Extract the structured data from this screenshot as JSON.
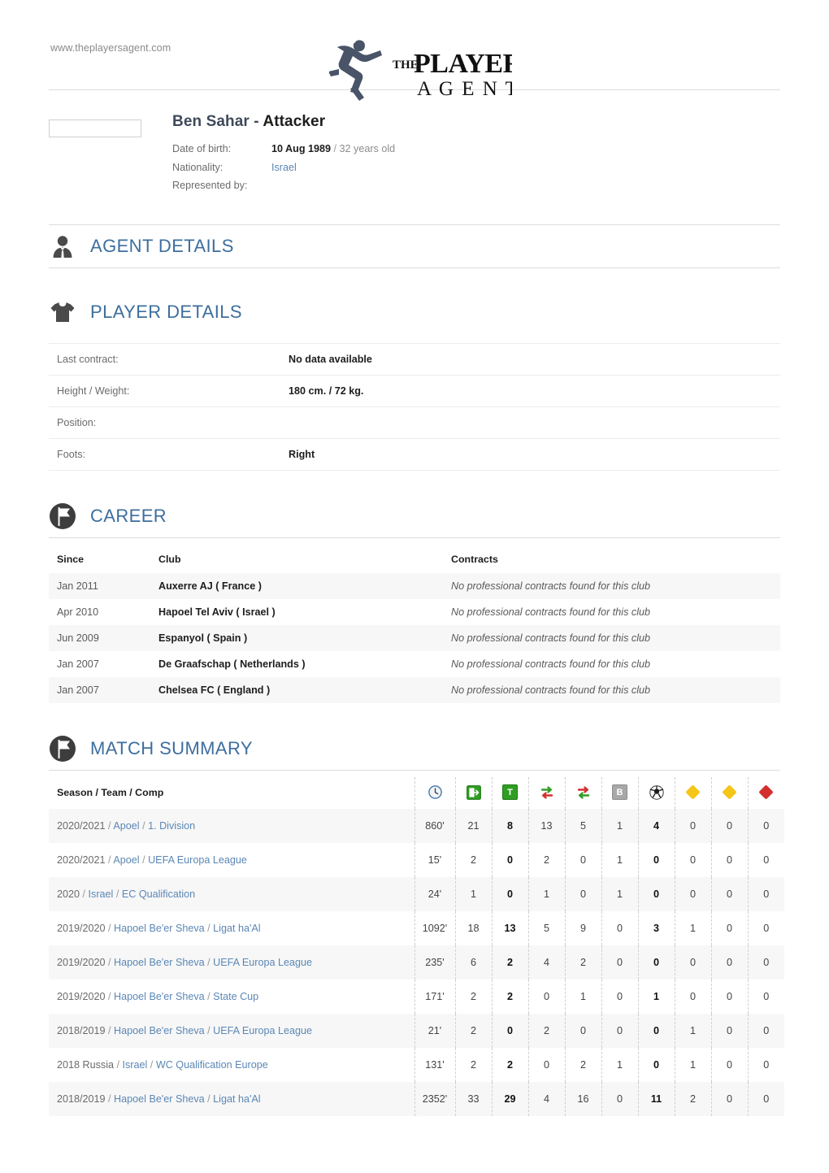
{
  "header": {
    "site_url": "www.theplayersagent.com",
    "logo_the": "THE",
    "logo_players": "PLAYERS'",
    "logo_agent": "A G E N T"
  },
  "player": {
    "name": "Ben Sahar",
    "name_separator": " - ",
    "position_title": "Attacker",
    "dob_label": "Date of birth:",
    "dob_value": "10 Aug 1989",
    "dob_separator": " / ",
    "age": "32 years old",
    "nationality_label": "Nationality:",
    "nationality_value": "Israel",
    "represented_label": "Represented by:",
    "represented_value": ""
  },
  "sections": {
    "agent_details": {
      "title": "AGENT DETAILS",
      "icon": "person-icon"
    },
    "player_details": {
      "title": "PLAYER DETAILS",
      "icon": "tshirt-icon"
    },
    "career": {
      "title": "CAREER",
      "icon": "flag-badge-icon"
    },
    "match_summary": {
      "title": "MATCH SUMMARY",
      "icon": "flag-badge-icon"
    }
  },
  "player_details": {
    "rows": [
      {
        "label": "Last contract:",
        "value": "No data available"
      },
      {
        "label": "Height / Weight:",
        "value": "180 cm. / 72 kg."
      },
      {
        "label": "Position:",
        "value": ""
      },
      {
        "label": "Foots:",
        "value": "Right"
      }
    ]
  },
  "career": {
    "columns": {
      "since": "Since",
      "club": "Club",
      "contracts": "Contracts"
    },
    "rows": [
      {
        "since": "Jan 2011",
        "club": "Auxerre AJ ( France )",
        "contracts": "No professional contracts found for this club"
      },
      {
        "since": "Apr 2010",
        "club": "Hapoel Tel Aviv ( Israel )",
        "contracts": "No professional contracts found for this club"
      },
      {
        "since": "Jun 2009",
        "club": "Espanyol ( Spain )",
        "contracts": "No professional contracts found for this club"
      },
      {
        "since": "Jan 2007",
        "club": "De Graafschap ( Netherlands )",
        "contracts": "No professional contracts found for this club"
      },
      {
        "since": "Jan 2007",
        "club": "Chelsea FC ( England )",
        "contracts": "No professional contracts found for this club"
      }
    ]
  },
  "match_summary": {
    "season_column_header": "Season / Team / Comp",
    "stat_columns": [
      {
        "icon": "clock-icon",
        "name": "minutes-played"
      },
      {
        "icon": "exit-box-icon",
        "name": "appearances"
      },
      {
        "icon": "t-box-icon",
        "name": "starting-eleven",
        "label": "T"
      },
      {
        "icon": "sub-out-icon",
        "name": "substituted-out"
      },
      {
        "icon": "sub-in-icon",
        "name": "substituted-in"
      },
      {
        "icon": "bench-box-icon",
        "name": "bench",
        "label": "B"
      },
      {
        "icon": "soccer-ball-icon",
        "name": "goals"
      },
      {
        "icon": "yellow-card-icon",
        "name": "yellow-cards"
      },
      {
        "icon": "second-yellow-card-icon",
        "name": "second-yellow-cards"
      },
      {
        "icon": "red-card-icon",
        "name": "red-cards"
      }
    ],
    "rows": [
      {
        "season": "2020/2021",
        "team": "Apoel",
        "comp": "1. Division",
        "stats": [
          "860'",
          "21",
          "8",
          "13",
          "5",
          "1",
          "4",
          "0",
          "0",
          "0"
        ]
      },
      {
        "season": "2020/2021",
        "team": "Apoel",
        "comp": "UEFA Europa League",
        "stats": [
          "15'",
          "2",
          "0",
          "2",
          "0",
          "1",
          "0",
          "0",
          "0",
          "0"
        ]
      },
      {
        "season": "2020",
        "team": "Israel",
        "comp": "EC Qualification",
        "stats": [
          "24'",
          "1",
          "0",
          "1",
          "0",
          "1",
          "0",
          "0",
          "0",
          "0"
        ]
      },
      {
        "season": "2019/2020",
        "team": "Hapoel Be'er Sheva",
        "comp": "Ligat ha'Al",
        "stats": [
          "1092'",
          "18",
          "13",
          "5",
          "9",
          "0",
          "3",
          "1",
          "0",
          "0"
        ]
      },
      {
        "season": "2019/2020",
        "team": "Hapoel Be'er Sheva",
        "comp": "UEFA Europa League",
        "stats": [
          "235'",
          "6",
          "2",
          "4",
          "2",
          "0",
          "0",
          "0",
          "0",
          "0"
        ]
      },
      {
        "season": "2019/2020",
        "team": "Hapoel Be'er Sheva",
        "comp": "State Cup",
        "stats": [
          "171'",
          "2",
          "2",
          "0",
          "1",
          "0",
          "1",
          "0",
          "0",
          "0"
        ]
      },
      {
        "season": "2018/2019",
        "team": "Hapoel Be'er Sheva",
        "comp": "UEFA Europa League",
        "stats": [
          "21'",
          "2",
          "0",
          "2",
          "0",
          "0",
          "0",
          "1",
          "0",
          "0"
        ]
      },
      {
        "season": "2018 Russia",
        "team": "Israel",
        "comp": "WC Qualification Europe",
        "stats": [
          "131'",
          "2",
          "2",
          "0",
          "2",
          "1",
          "0",
          "1",
          "0",
          "0"
        ]
      },
      {
        "season": "2018/2019",
        "team": "Hapoel Be'er Sheva",
        "comp": "Ligat ha'Al",
        "stats": [
          "2352'",
          "33",
          "29",
          "4",
          "16",
          "0",
          "11",
          "2",
          "0",
          "0"
        ]
      }
    ]
  },
  "colors": {
    "heading_blue": "#3d6e9e",
    "link_blue": "#5b87b5",
    "green": "#2f9e22",
    "yellow_card": "#f5c518",
    "red_card": "#d42f2f",
    "row_stripe": "#f7f7f7"
  }
}
